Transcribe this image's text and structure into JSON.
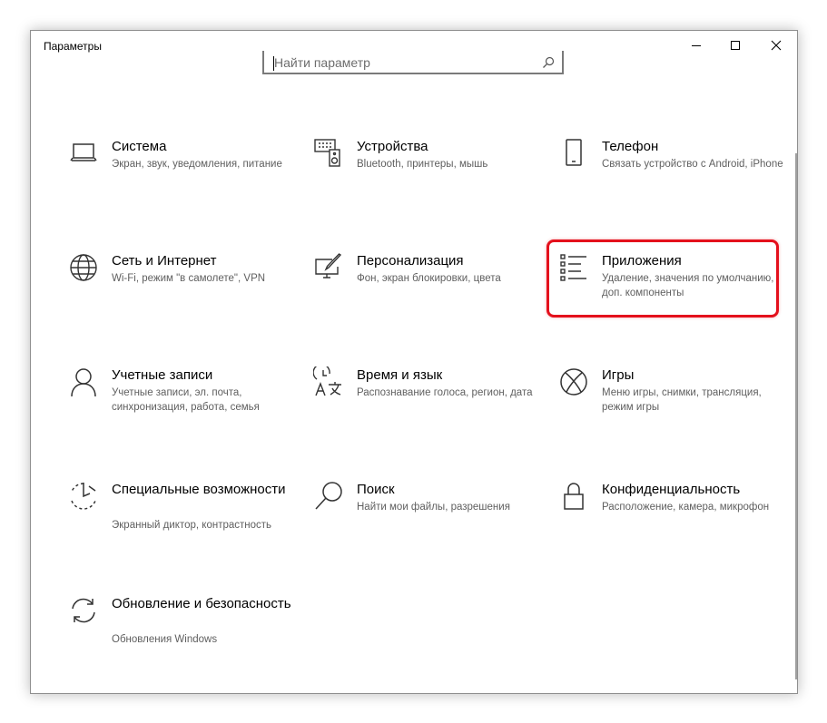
{
  "window": {
    "title": "Параметры",
    "controls": {
      "minimize": "minimize-icon",
      "maximize": "maximize-icon",
      "close": "close-icon"
    }
  },
  "search": {
    "placeholder": "Найти параметр",
    "icon": "search-icon"
  },
  "highlight_color": "#e4101c",
  "tiles": [
    {
      "title": "Система",
      "desc": "Экран, звук, уведомления, питание",
      "icon": "laptop-icon"
    },
    {
      "title": "Устройства",
      "desc": "Bluetooth, принтеры, мышь",
      "icon": "devices-icon"
    },
    {
      "title": "Телефон",
      "desc": "Связать устройство с Android, iPhone",
      "icon": "phone-icon"
    },
    {
      "title": "Сеть и Интернет",
      "desc": "Wi-Fi, режим \"в самолете\", VPN",
      "icon": "globe-icon"
    },
    {
      "title": "Персонализация",
      "desc": "Фон, экран блокировки, цвета",
      "icon": "personalization-icon"
    },
    {
      "title": "Приложения",
      "desc": "Удаление, значения по умолчанию, доп. компоненты",
      "icon": "apps-list-icon",
      "highlighted": true
    },
    {
      "title": "Учетные записи",
      "desc": "Учетные записи, эл. почта, синхронизация, работа, семья",
      "icon": "person-icon"
    },
    {
      "title": "Время и язык",
      "desc": "Распознавание голоса, регион, дата",
      "icon": "time-language-icon"
    },
    {
      "title": "Игры",
      "desc": "Меню игры, снимки, трансляция, режим игры",
      "icon": "xbox-icon"
    },
    {
      "title": "Специальные возможности",
      "desc": "Экранный диктор, контрастность",
      "icon": "ease-of-access-icon"
    },
    {
      "title": "Поиск",
      "desc": "Найти мои файлы, разрешения",
      "icon": "search-icon"
    },
    {
      "title": "Конфиденциальность",
      "desc": "Расположение, камера, микрофон",
      "icon": "lock-icon"
    },
    {
      "title": "Обновление и безопасность",
      "desc": "Обновления Windows",
      "icon": "sync-icon"
    }
  ]
}
